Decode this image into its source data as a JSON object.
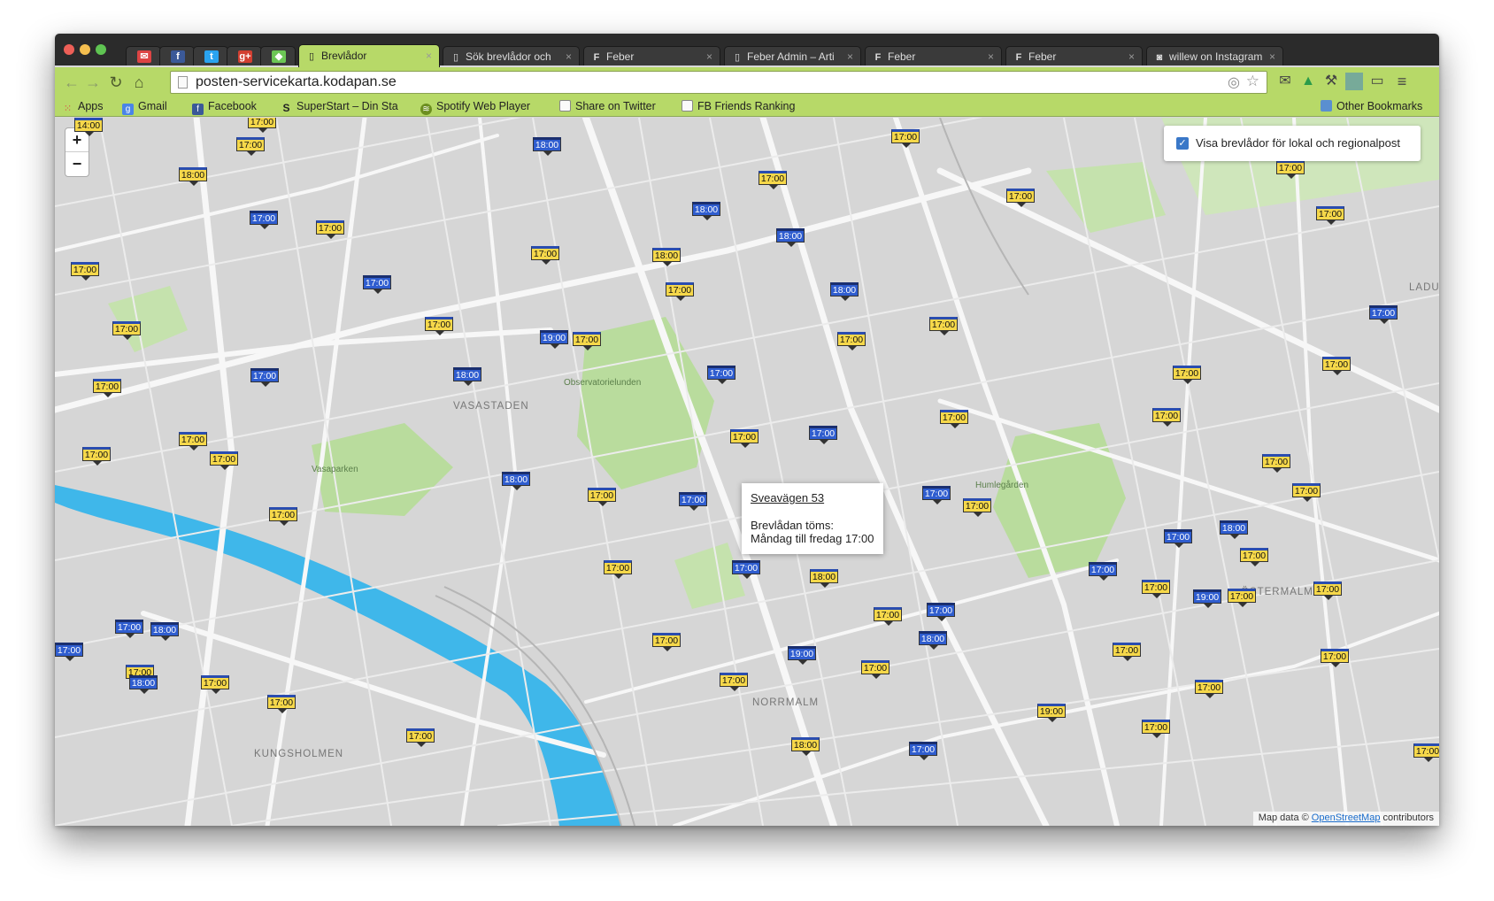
{
  "browser": {
    "tabs": [
      {
        "label": "Brevlådor",
        "active": true
      },
      {
        "label": "Sök brevlådor och"
      },
      {
        "label": "Feber"
      },
      {
        "label": "Feber Admin – Arti"
      },
      {
        "label": "Feber"
      },
      {
        "label": "Feber"
      },
      {
        "label": "willew on Instagram"
      }
    ],
    "pinned_tabs": [
      "gmail-icon",
      "facebook-icon",
      "twitter-icon",
      "google-plus-icon",
      "feedly-icon"
    ],
    "url": "posten-servicekarta.kodapan.se",
    "bookmarks": [
      {
        "label": "Apps",
        "icon": "apps-grid-icon"
      },
      {
        "label": "Gmail",
        "icon": "google-icon"
      },
      {
        "label": "Facebook",
        "icon": "facebook-icon"
      },
      {
        "label": "SuperStart – Din Sta",
        "icon": "superstart-icon"
      },
      {
        "label": "Spotify Web Player",
        "icon": "spotify-icon"
      },
      {
        "label": "Share on Twitter",
        "icon": "page-icon"
      },
      {
        "label": "FB Friends Ranking",
        "icon": "page-icon"
      }
    ],
    "other_bookmarks": "Other Bookmarks"
  },
  "map": {
    "zoom_in": "+",
    "zoom_out": "−",
    "layer_toggle_label": "Visa brevlådor för lokal och regionalpost",
    "layer_toggle_checked": true,
    "popup": {
      "title": "Sveavägen 53",
      "line1": "Brevlådan töms:",
      "line2": "Måndag till fredag 17:00"
    },
    "attribution_prefix": "Map data ©",
    "attribution_link": "OpenStreetMap",
    "attribution_suffix": "contributors",
    "districts": [
      "VASASTADEN",
      "NORRMALM",
      "KUNGSHOLMEN",
      "ÖSTERMALM",
      "LADU"
    ],
    "parks": [
      "Observatorielunden",
      "Vasaparken",
      "Humlegården"
    ],
    "colors": {
      "yellow_marker": "#f6d84a",
      "blue_marker": "#2f5dcf",
      "water": "#3fb7ea",
      "park": "#b9dc9d",
      "toolbar": "#b7d968"
    }
  }
}
